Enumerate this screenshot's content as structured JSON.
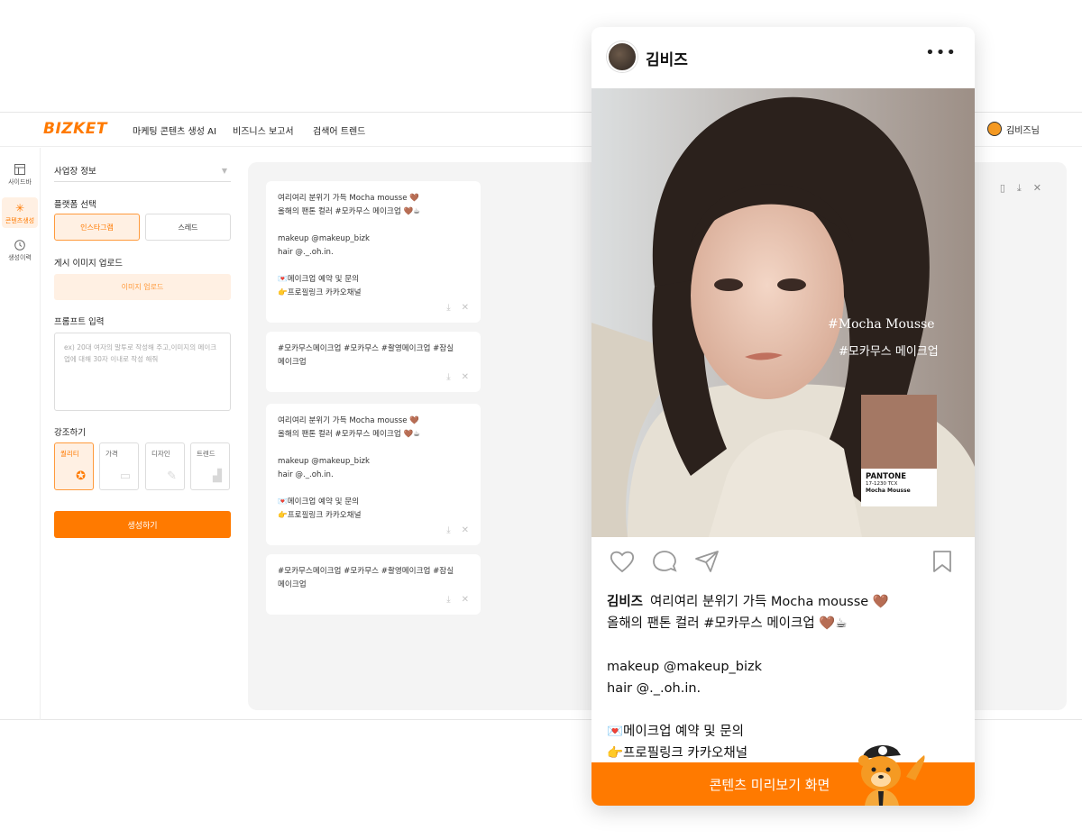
{
  "app": {
    "logo": "BIZKET",
    "nav": [
      "마케팅 콘텐츠 생성 AI",
      "비즈니스 보고서",
      "검색어 트렌드"
    ],
    "user_name": "김비즈님"
  },
  "leftnav": {
    "items": [
      {
        "label": "사이드바",
        "icon": "layout-icon"
      },
      {
        "label": "콘텐츠생성",
        "icon": "sparkle-icon"
      },
      {
        "label": "생성이력",
        "icon": "clock-icon"
      }
    ]
  },
  "form": {
    "business_info": "사업장 정보",
    "platform_label": "플랫폼 선택",
    "platforms": [
      "인스타그램",
      "스레드"
    ],
    "upload_label": "게시 이미지 업로드",
    "upload_button": "이미지 업로드",
    "prompt_label": "프롬프트 입력",
    "prompt_placeholder": "ex) 20대 여자의 말투로 작성해 주고,이미지의 메이크업에 대해 30자 이내로 작성 해줘",
    "emphasis_label": "강조하기",
    "emphasis": [
      "퀄리티",
      "가격",
      "디자인",
      "트렌드"
    ],
    "generate_button": "생성하기"
  },
  "results": [
    {
      "lines": [
        "여리여리 분위기 가득 Mocha mousse 🤎",
        "올해의 팬톤 컬러 #모카무스 메이크업 🤎☕",
        "",
        "makeup @makeup_bizk",
        "hair @._.oh.in.",
        "",
        "💌메이크업 예약 및 문의",
        "👉프로필링크 카카오채널"
      ]
    },
    {
      "lines": [
        "#모카무스메이크업 #모카무스 #촬영메이크업 #잠실",
        "메이크업"
      ]
    },
    {
      "lines": [
        "여리여리 분위기 가득 Mocha mousse 🤎",
        "올해의 팬톤 컬러 #모카무스 메이크업 🤎☕",
        "",
        "makeup @makeup_bizk",
        "hair @._.oh.in.",
        "",
        "💌메이크업 예약 및 문의",
        "👉프로필링크 카카오채널"
      ]
    },
    {
      "lines": [
        "#모카무스메이크업 #모카무스 #촬영메이크업 #잠실",
        "메이크업"
      ]
    }
  ],
  "preview": {
    "account_name": "김비즈",
    "more": "•••",
    "photo_text": [
      "#Mocha Mousse",
      "#모카무스 메이크업"
    ],
    "pantone": {
      "brand": "PANTONE",
      "code": "17-1230 TCX",
      "name": "Mocha Mousse",
      "color": "#a47864"
    },
    "caption_lines": [
      "여리여리 분위기 가득 Mocha mousse 🤎",
      "올해의 팬톤 컬러 #모카무스 메이크업 🤎☕",
      "",
      "makeup @makeup_bizk",
      "hair @._.oh.in.",
      "",
      "💌메이크업 예약 및 문의",
      "👉프로필링크 카카오채널"
    ],
    "footer": "콘텐츠 미리보기 화면"
  },
  "colors": {
    "accent": "#ff7a00",
    "accent_light": "#fff0e3"
  }
}
